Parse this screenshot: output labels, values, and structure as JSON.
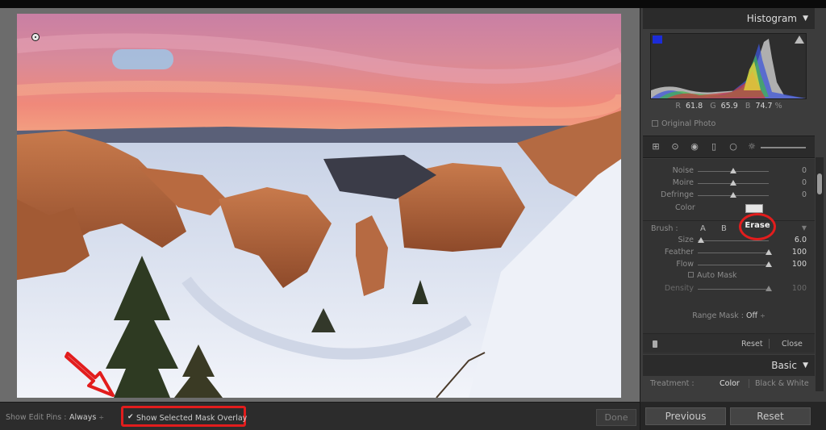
{
  "toolbar": {
    "show_edit_pins_label": "Show Edit Pins :",
    "show_edit_pins_value": "Always",
    "mask_overlay_label": "Show Selected Mask Overlay",
    "mask_overlay_checked": "✔",
    "done_label": "Done"
  },
  "histogram": {
    "title": "Histogram",
    "r_label": "R",
    "r_value": "61.8",
    "g_label": "G",
    "g_value": "65.9",
    "b_label": "B",
    "b_value": "74.7",
    "unit": "%",
    "original_photo_label": "Original Photo"
  },
  "brush_panel": {
    "sliders": [
      {
        "label": "Noise",
        "value": "0",
        "level": 0.5
      },
      {
        "label": "Moire",
        "value": "0",
        "level": 0.5
      },
      {
        "label": "Defringe",
        "value": "0",
        "level": 0.5
      }
    ],
    "color_label": "Color",
    "brush_label": "Brush :",
    "brush_a": "A",
    "brush_b": "B",
    "brush_erase": "Erase",
    "brush_sliders": [
      {
        "label": "Size",
        "value": "6.0",
        "level": 0.05
      },
      {
        "label": "Feather",
        "value": "100",
        "level": 1.0
      },
      {
        "label": "Flow",
        "value": "100",
        "level": 1.0
      }
    ],
    "auto_mask_label": "Auto Mask",
    "density_label": "Density",
    "density_value": "100",
    "range_mask_label": "Range Mask :",
    "range_mask_value": "Off",
    "reset_label": "Reset",
    "close_label": "Close"
  },
  "basic": {
    "title": "Basic",
    "treatment_label": "Treatment :",
    "treatment_color": "Color",
    "treatment_bw": "Black & White"
  },
  "bottom": {
    "previous_label": "Previous",
    "reset_label": "Reset"
  },
  "colors": {
    "highlight_red": "#e21d1d",
    "panel_bg": "#3c3c3c"
  }
}
